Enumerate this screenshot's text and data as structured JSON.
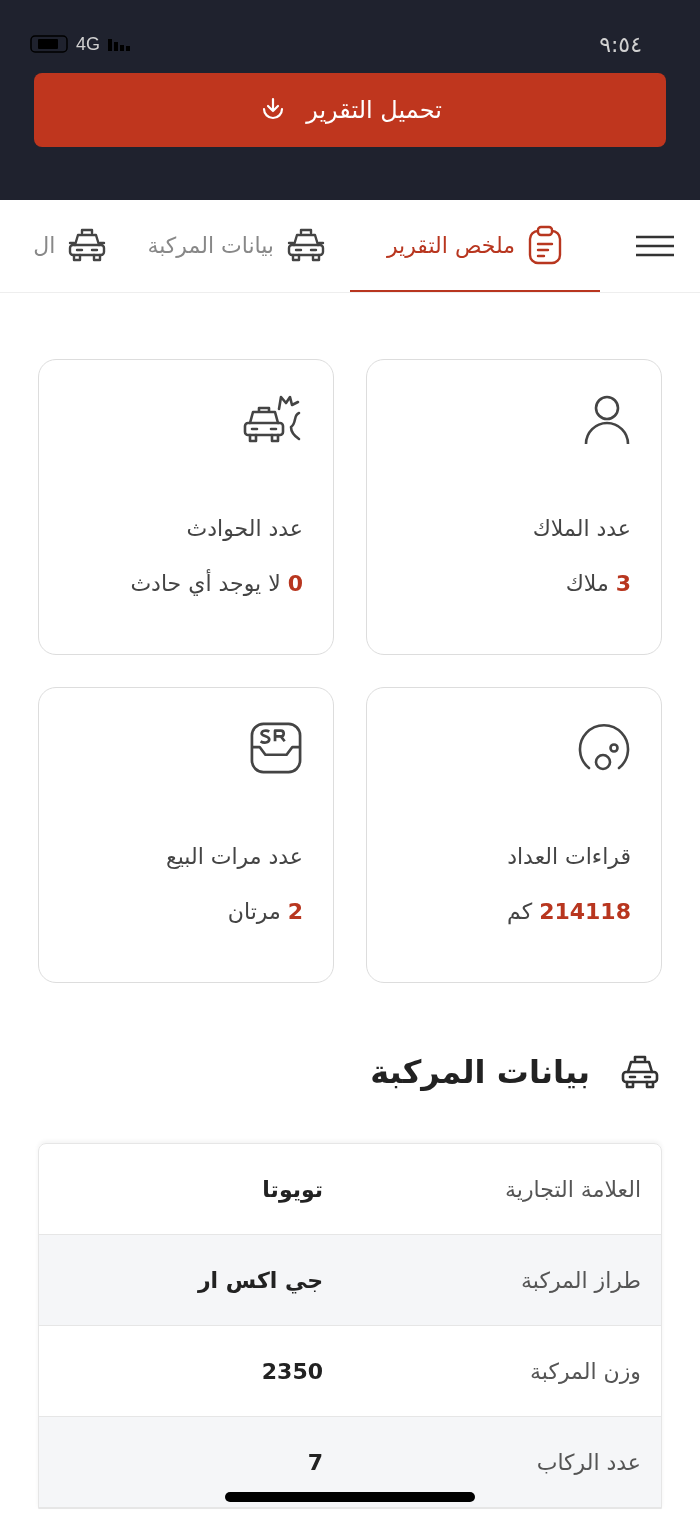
{
  "status_bar": {
    "time": "٩:٥٤",
    "network": "4G"
  },
  "download_button": {
    "label": "تحميل التقرير"
  },
  "tabs": [
    {
      "label": "ملخص التقرير",
      "selected": true
    },
    {
      "label": "بيانات المركبة",
      "selected": false
    },
    {
      "label": "ال",
      "selected": false
    }
  ],
  "summary_cards": [
    {
      "title": "عدد الملاك",
      "count": "3",
      "text": "ملاك"
    },
    {
      "title": "عدد الحوادث",
      "count": "0",
      "text": "لا يوجد أي حادث"
    },
    {
      "title": "قراءات العداد",
      "count": "214118",
      "text": "كم"
    },
    {
      "title": "عدد مرات البيع",
      "count": "2",
      "text": "مرتان"
    }
  ],
  "vehicle_section": {
    "title": "بيانات المركبة",
    "rows": [
      {
        "label": "العلامة التجارية",
        "value": "تويوتا"
      },
      {
        "label": "طراز المركبة",
        "value": "جي اكس  ار"
      },
      {
        "label": "وزن المركبة",
        "value": "2350"
      },
      {
        "label": "عدد الركاب",
        "value": "7"
      }
    ]
  }
}
